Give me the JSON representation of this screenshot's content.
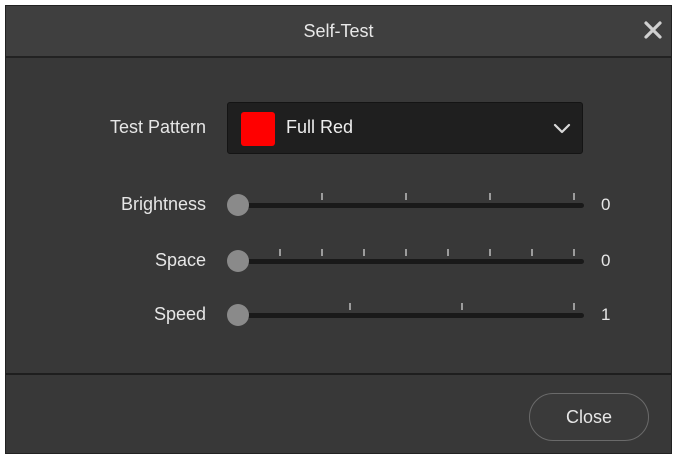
{
  "dialog": {
    "title": "Self-Test",
    "close_icon": "close-icon"
  },
  "test_pattern": {
    "label": "Test Pattern",
    "selected": "Full Red",
    "swatch_color": "#ff0000",
    "dropdown_icon": "chevron-down-icon"
  },
  "sliders": [
    {
      "label": "Brightness",
      "value": "0",
      "level": 0,
      "tick_count": 4
    },
    {
      "label": "Space",
      "value": "0",
      "level": 0,
      "tick_count": 8
    },
    {
      "label": "Speed",
      "value": "1",
      "level": 0,
      "tick_count": 3
    }
  ],
  "footer": {
    "close_label": "Close"
  },
  "colors": {
    "dialog_bg": "#383838",
    "track": "#191919",
    "thumb": "#8a8a8a",
    "text": "#e6e6e6"
  }
}
